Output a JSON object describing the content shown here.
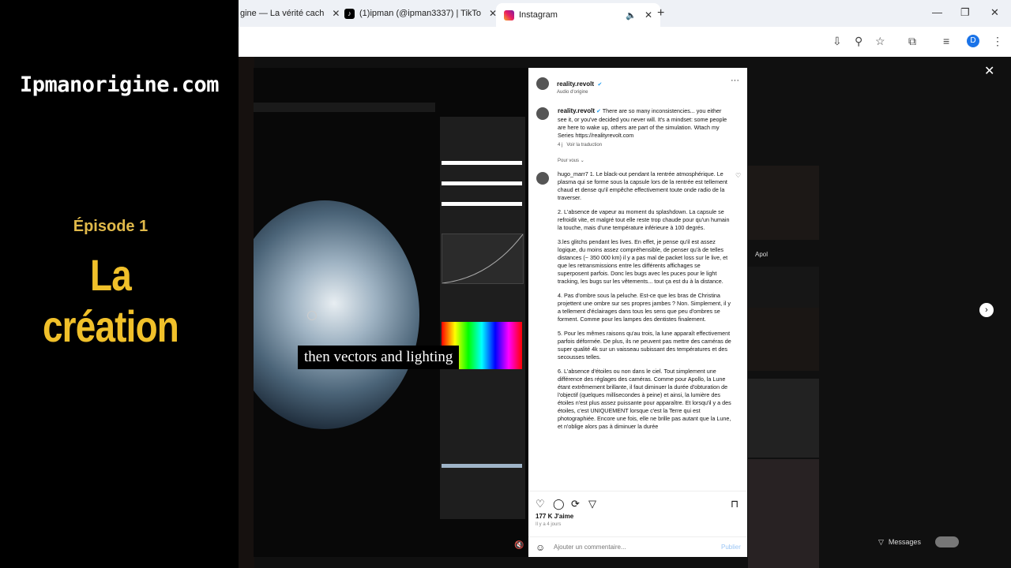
{
  "left_panel": {
    "site": "Ipmanorigine.com",
    "episode": "Épisode 1",
    "title": "La création"
  },
  "tabs": [
    {
      "label": "gine — La vérité cach",
      "active": false
    },
    {
      "label": "(1)ipman (@ipman3337) | TikTo",
      "active": false
    },
    {
      "label": "Instagram",
      "active": true
    }
  ],
  "post": {
    "author": "reality.revolt",
    "audio": "Audio d'origine",
    "caption": "There are so many inconsistencies... you either see it, or you've decided you never will. It's a mindset: some people are here to wake up, others are part of the simulation. Wtach my Series https://realityrevolt.com",
    "caption_age": "4 j",
    "translate": "Voir la traduction",
    "filter": "Pour vous",
    "comment_user": "hugo_marr7",
    "comment_paragraphs": [
      "1. Le black-out pendant la rentrée atmosphérique. Le plasma qui se forme sous la capsule lors de la rentrée est tellement chaud et dense qu'il empêche effectivement toute onde radio de la traverser.",
      "2. L'absence de vapeur au moment du splashdown. La capsule se refroidit vite, et malgré tout elle reste trop chaude pour qu'un humain la touche, mais d'une température inférieure à 100 degrés.",
      "3.les glitchs pendant les lives. En effet, je pense qu'il est assez logique, du moins assez compréhensible, de penser qu'à de telles distances (~ 350 000 km) il y a pas mal de packet loss sur le live, et que les retransmissions entre les différents affichages se superposent parfois. Donc les bugs avec les puces pour le light tracking, les bugs sur les vêtements... tout ça est du à la distance.",
      "4. Pas d'ombre sous la peluche. Est-ce que les bras de Christina projettent une ombre sur ses propres jambes ? Non. Simplement, il y a tellement d'éclairages dans tous les sens que peu d'ombres se forment. Comme pour les lampes des dentistes finalement.",
      "5. Pour les mêmes raisons qu'au trois, la lune apparaît effectivement parfois déformée. De plus, ils ne peuvent pas mettre des caméras de super qualité 4k sur un vaisseau subissant des températures et des secousses telles.",
      "6. L'absence d'étoiles ou non dans le ciel. Tout simplement une différence des réglages des caméras. Comme pour Apollo, la Lune étant extrêmement brillante, il faut diminuer la durée d'obturation de l'objectif (quelques millisecondes à peine) et ainsi, la lumière des étoiles n'est plus assez puissante pour apparaître. Et lorsqu'il y a des étoiles, c'est UNIQUEMENT lorsque c'est la Terre qui est photographiée. Encore une fois, elle ne brille pas autant que la Lune, et n'oblige alors pas à diminuer la durée"
    ],
    "likes": "177 K J'aime",
    "age": "Il y a 4 jours",
    "add_comment_placeholder": "Ajouter un commentaire...",
    "publish": "Publier"
  },
  "video": {
    "caption": "then vectors and lighting"
  },
  "background": {
    "apo_label": "Apol",
    "messages": "Messages"
  },
  "colors": {
    "accent": "#f0c02a",
    "instagram_blue": "#1d9bf0",
    "profile": "#1a73e8"
  },
  "profile_initial": "D"
}
